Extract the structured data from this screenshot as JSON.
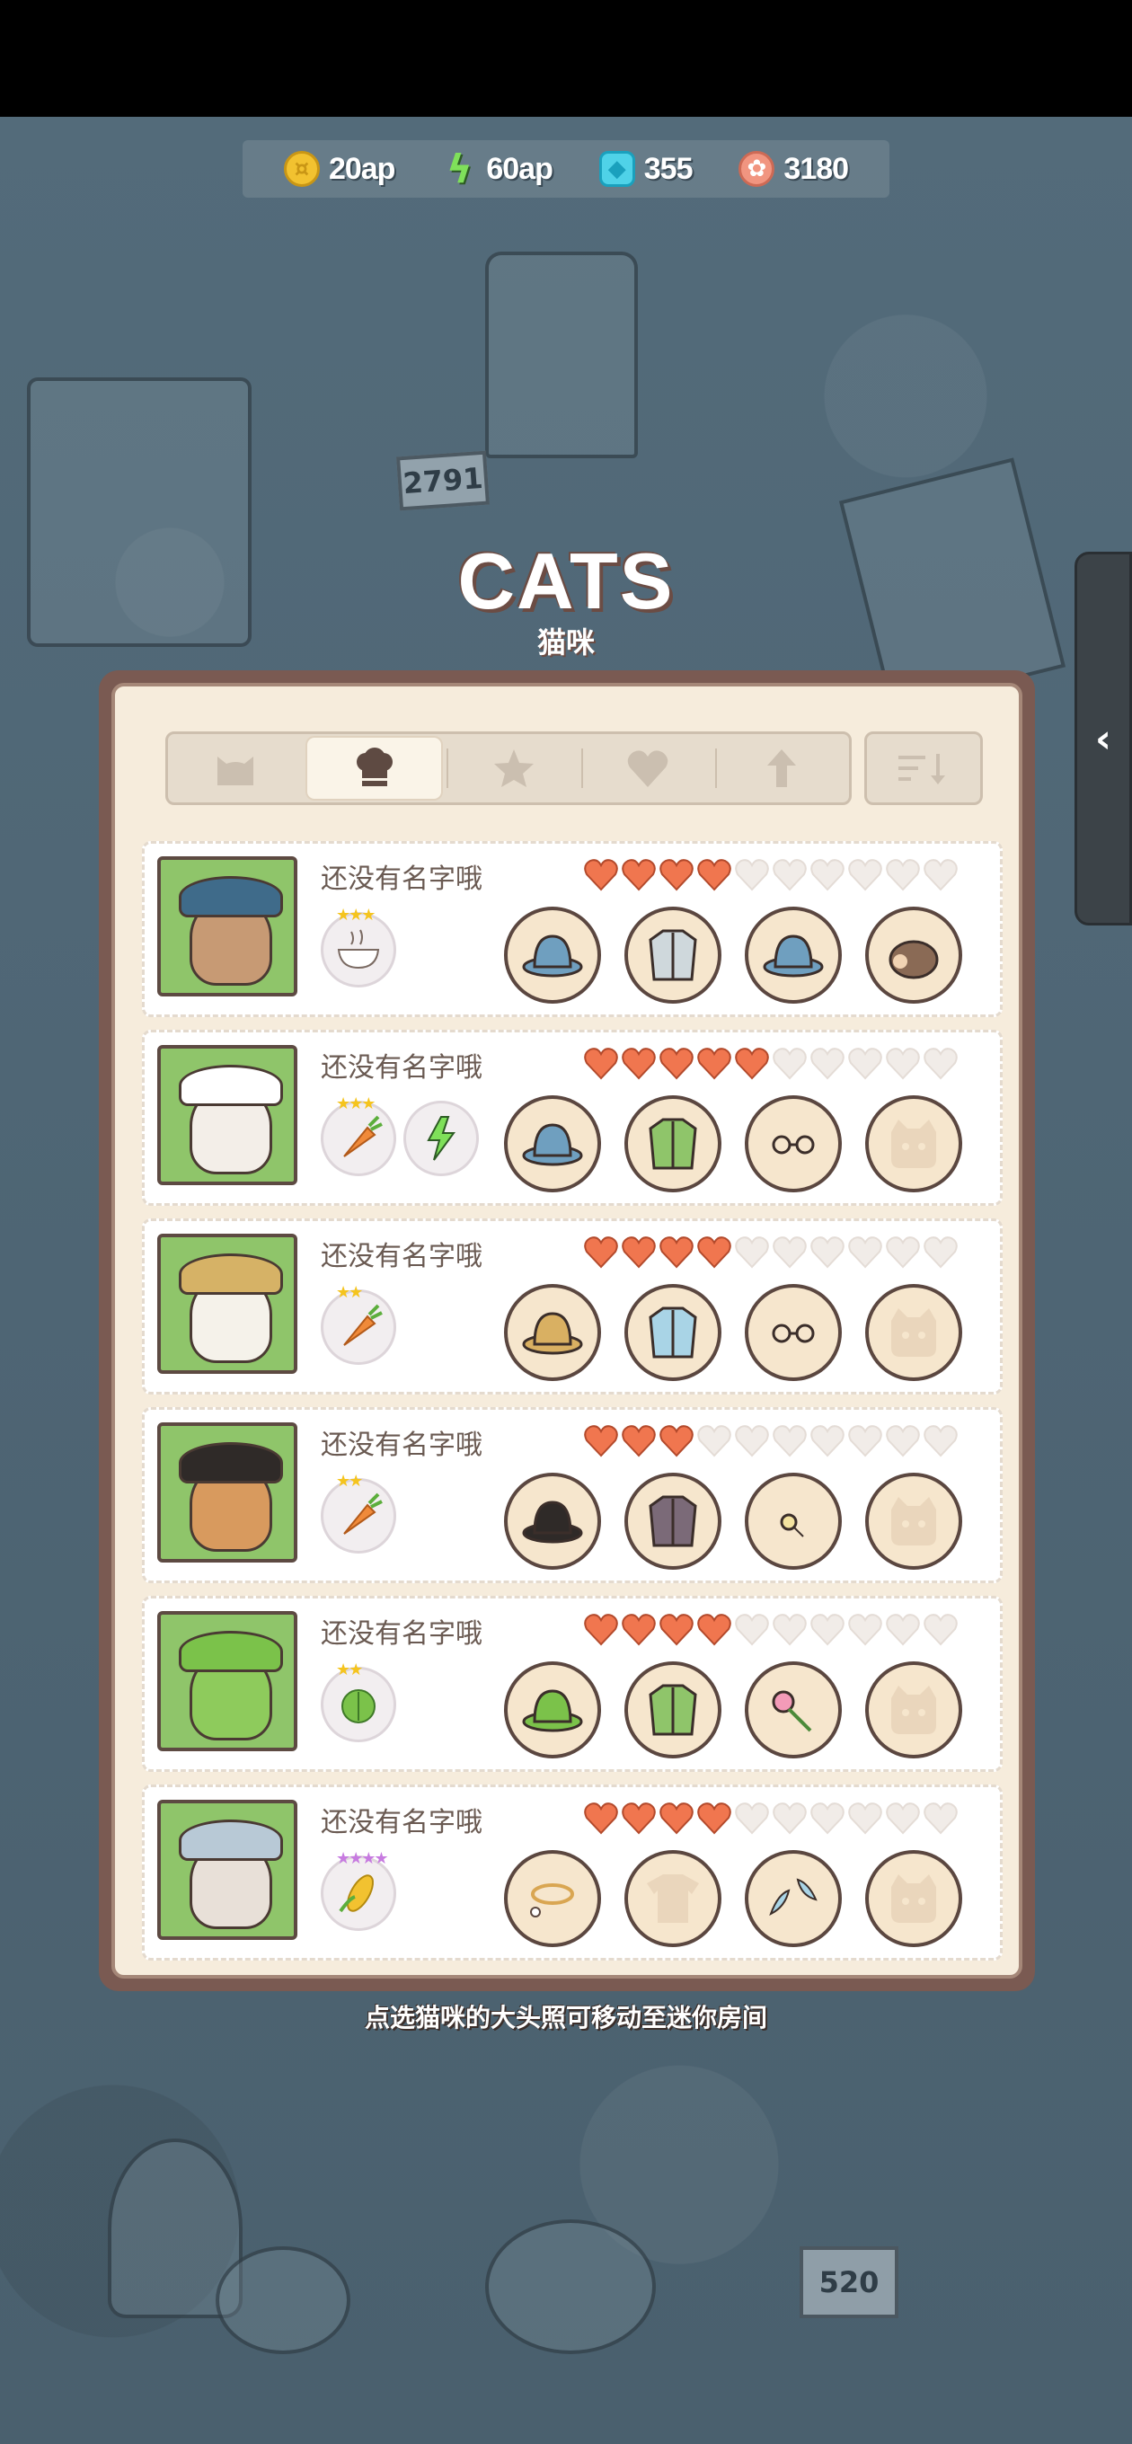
{
  "currencies": [
    {
      "icon": "coin-icon",
      "value": "20ap"
    },
    {
      "icon": "lightning-icon",
      "value": "60ap"
    },
    {
      "icon": "gem-icon",
      "value": "355"
    },
    {
      "icon": "paw-token-icon",
      "value": "3180"
    }
  ],
  "background_signs": {
    "chair_sign": "2791",
    "lv_sign": "520"
  },
  "title": {
    "en": "CATS",
    "cn": "猫咪"
  },
  "tabs": [
    "cat-tab",
    "food-tab",
    "star-tab",
    "heart-tab",
    "level-up-tab"
  ],
  "active_tab": "food-tab",
  "cats": [
    {
      "name": "还没有名字哦",
      "hearts": 4,
      "hearts_max": 10,
      "portrait": "starry-hat-cat",
      "foods": [
        {
          "icon": "soup-bowl-icon",
          "stars": 3
        }
      ],
      "gear": [
        "star-cap-icon",
        "blue-vest-icon",
        "flat-cap-icon",
        "hedgehog-icon"
      ]
    },
    {
      "name": "还没有名字哦",
      "hearts": 5,
      "hearts_max": 10,
      "portrait": "blue-cap-cat",
      "foods": [
        {
          "icon": "carrot-icon",
          "stars": 3
        },
        {
          "icon": "energy-icon",
          "stars": 0
        }
      ],
      "gear": [
        "blue-baseball-cap-icon",
        "green-vest-icon",
        "glasses-icon",
        "empty-slot-icon"
      ]
    },
    {
      "name": "还没有名字哦",
      "hearts": 4,
      "hearts_max": 10,
      "portrait": "straw-hat-cat",
      "foods": [
        {
          "icon": "carrot-icon",
          "stars": 2
        }
      ],
      "gear": [
        "straw-hat-icon",
        "blue-shirt-icon",
        "mustache-glasses-icon",
        "empty-slot-icon"
      ]
    },
    {
      "name": "还没有名字哦",
      "hearts": 3,
      "hearts_max": 10,
      "portrait": "top-hat-cat",
      "foods": [
        {
          "icon": "carrot-icon",
          "stars": 2
        }
      ],
      "gear": [
        "top-hat-icon",
        "sheriff-vest-icon",
        "monocle-icon",
        "empty-slot-icon"
      ]
    },
    {
      "name": "还没有名字哦",
      "hearts": 4,
      "hearts_max": 10,
      "portrait": "frog-hood-cat",
      "foods": [
        {
          "icon": "lettuce-icon",
          "stars": 2
        }
      ],
      "gear": [
        "frog-hood-icon",
        "green-jacket-icon",
        "rose-icon",
        "empty-slot-icon"
      ]
    },
    {
      "name": "还没有名字哦",
      "hearts": 4,
      "hearts_max": 10,
      "portrait": "angel-cat",
      "foods": [
        {
          "icon": "corn-icon",
          "stars": 4
        }
      ],
      "gear": [
        "halo-icon",
        "empty-shirt-slot-icon",
        "wings-icon",
        "empty-slot-icon"
      ]
    }
  ],
  "hint": "点选猫咪的大头照可移动至迷你房间",
  "colors": {
    "heart_filled": "#f0764f",
    "heart_empty": "#f1ece8",
    "panel_frame": "#7a5a52",
    "panel_bg": "#f6ecdc",
    "portrait_bg": "#8fc56a",
    "gear_bg": "#f6e6cd",
    "star": "#f5c41e",
    "star_purple": "#c77be0"
  }
}
